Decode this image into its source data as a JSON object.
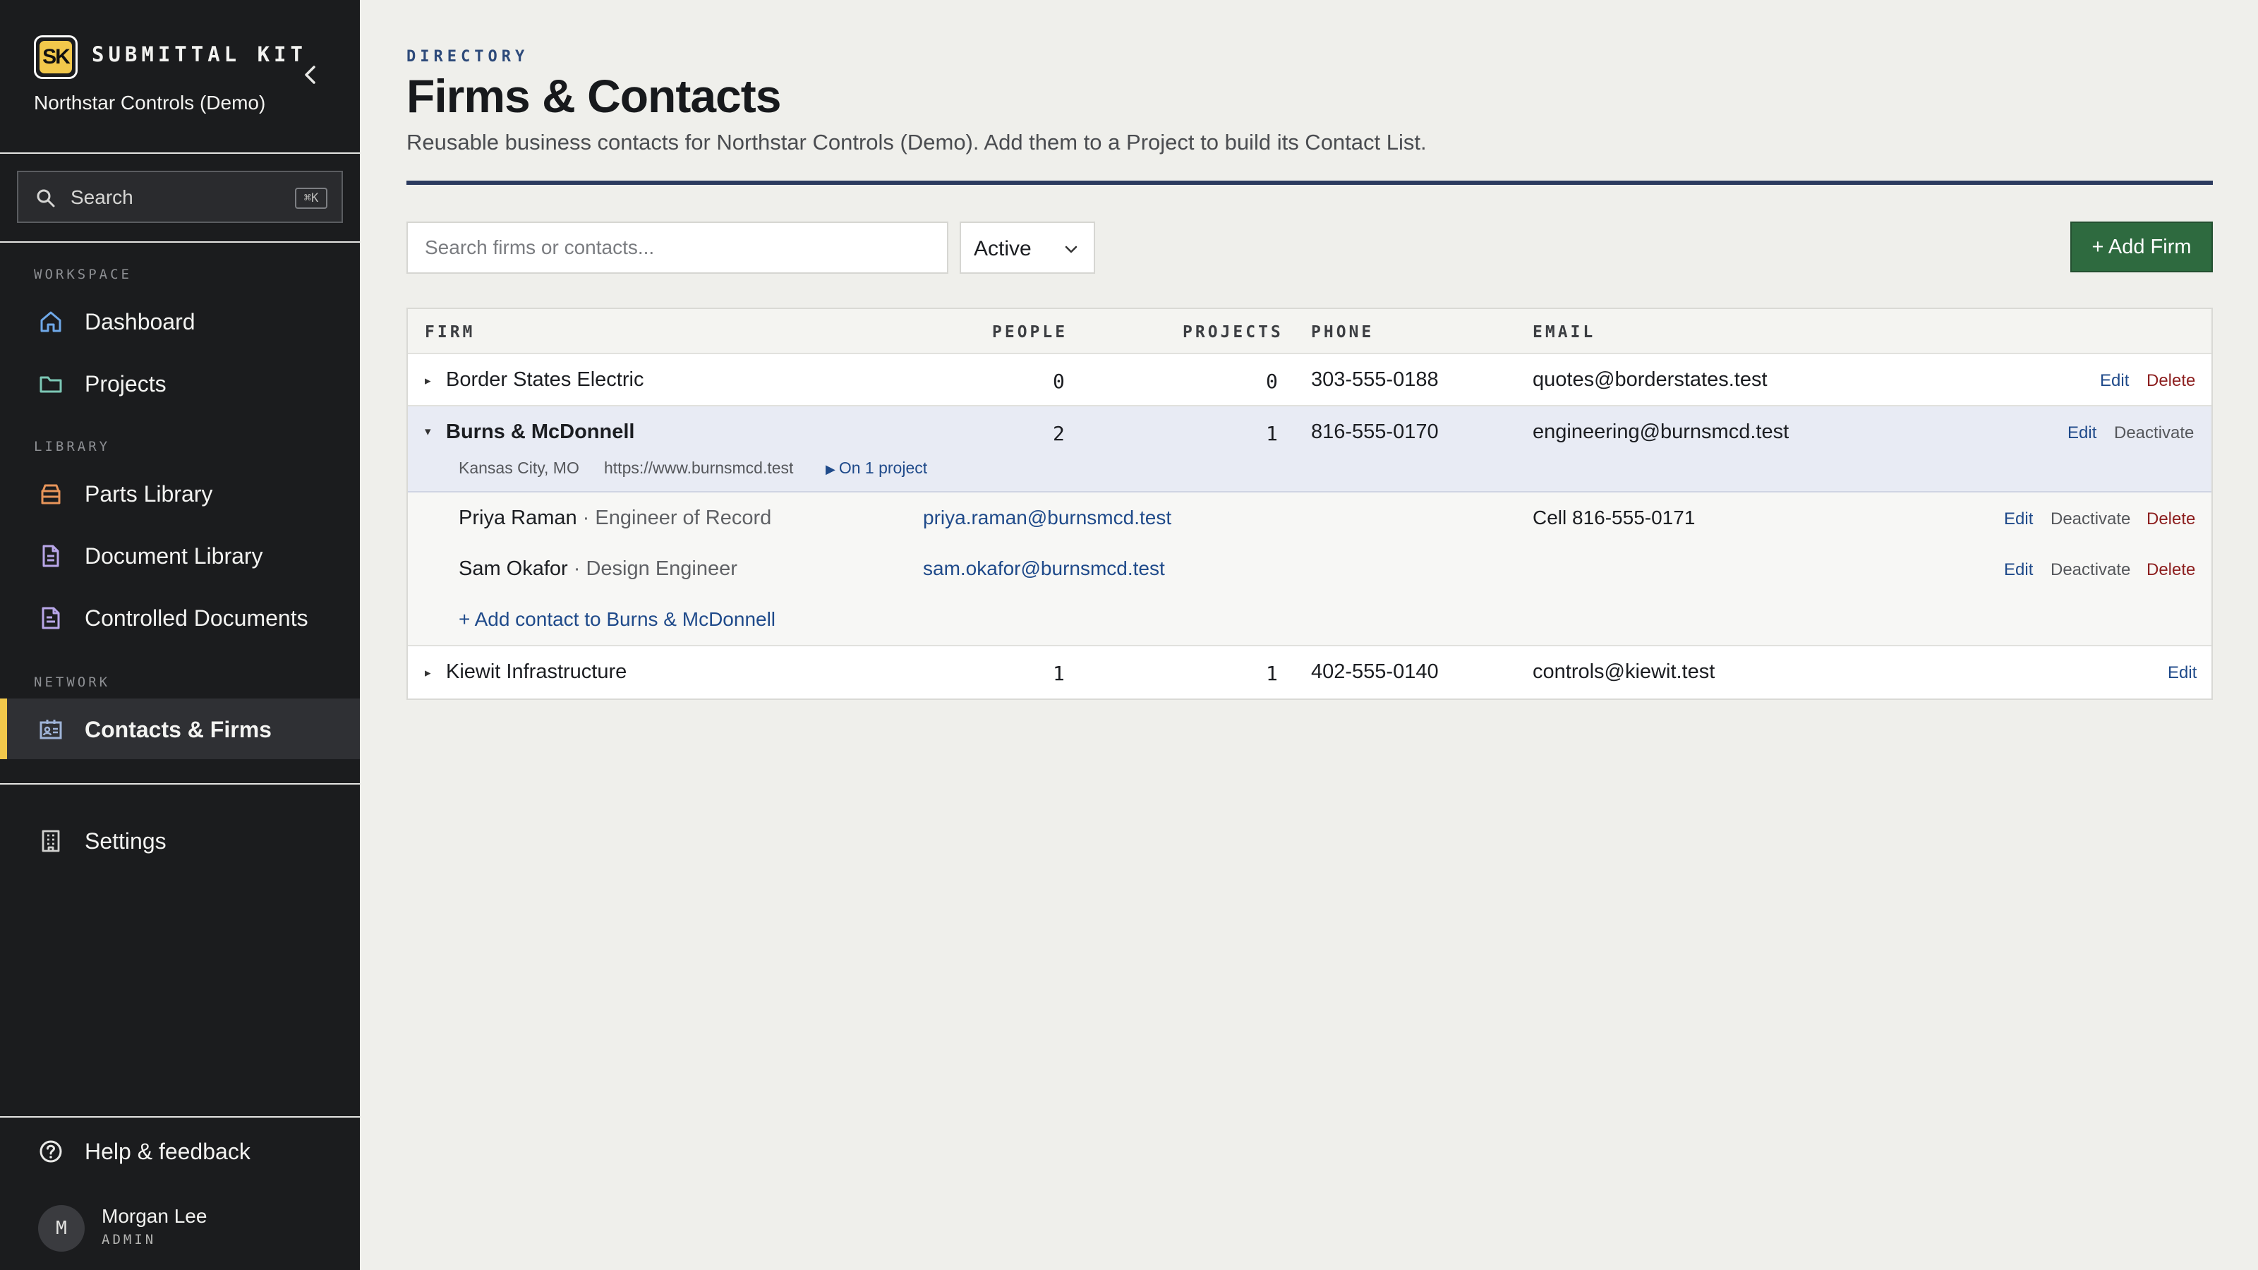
{
  "app": {
    "logo_text": "SK",
    "brand_name": "SUBMITTAL KIT",
    "org_name": "Northstar Controls (Demo)"
  },
  "sidebar": {
    "search_label": "Search",
    "search_shortcut": "⌘K",
    "sections": {
      "workspace": "WORKSPACE",
      "library": "LIBRARY",
      "network": "NETWORK"
    },
    "items": {
      "dashboard": "Dashboard",
      "projects": "Projects",
      "parts_library": "Parts Library",
      "document_library": "Document Library",
      "controlled_documents": "Controlled Documents",
      "contacts_firms": "Contacts & Firms",
      "settings": "Settings",
      "help": "Help & feedback"
    },
    "active_item": "contacts_firms",
    "user": {
      "initial": "M",
      "name": "Morgan Lee",
      "role": "ADMIN"
    }
  },
  "header": {
    "eyebrow": "DIRECTORY",
    "title": "Firms & Contacts",
    "subtitle": "Reusable business contacts for Northstar Controls (Demo). Add them to a Project to build its Contact List."
  },
  "toolbar": {
    "search_placeholder": "Search firms or contacts...",
    "status_value": "Active",
    "add_firm_label": "+ Add Firm"
  },
  "table": {
    "columns": {
      "firm": "FIRM",
      "people": "PEOPLE",
      "projects": "PROJECTS",
      "phone": "PHONE",
      "email": "EMAIL"
    },
    "rows": [
      {
        "firm": "Border States Electric",
        "people": "0",
        "projects": "0",
        "phone": "303-555-0188",
        "email": "quotes@borderstates.test",
        "actions": {
          "edit": "Edit",
          "delete": "Delete"
        }
      },
      {
        "firm": "Burns & McDonnell",
        "people": "2",
        "projects": "1",
        "phone": "816-555-0170",
        "email": "engineering@burnsmcd.test",
        "location": "Kansas City, MO",
        "website": "https://www.burnsmcd.test",
        "projects_link": "On 1 project",
        "actions": {
          "edit": "Edit",
          "deactivate": "Deactivate"
        },
        "contacts": [
          {
            "name": "Priya Raman",
            "role": " · Engineer of Record",
            "email": "priya.raman@burnsmcd.test",
            "phone": "Cell 816-555-0171",
            "actions": {
              "edit": "Edit",
              "deactivate": "Deactivate",
              "delete": "Delete"
            }
          },
          {
            "name": "Sam Okafor",
            "role": " · Design Engineer",
            "email": "sam.okafor@burnsmcd.test",
            "phone": "",
            "actions": {
              "edit": "Edit",
              "deactivate": "Deactivate",
              "delete": "Delete"
            }
          }
        ],
        "add_contact_label": "+ Add contact to Burns & McDonnell"
      },
      {
        "firm": "Kiewit Infrastructure",
        "people": "1",
        "projects": "1",
        "phone": "402-555-0140",
        "email": "controls@kiewit.test",
        "actions": {
          "edit": "Edit"
        }
      }
    ]
  },
  "colors": {
    "sidebar_bg": "#1b1c1e",
    "accent_yellow": "#f2c84b",
    "primary_green": "#2e6a3f",
    "link_blue": "#1f4a8a",
    "danger_red": "#8c1e1e",
    "rule_navy": "#2b3a5e"
  }
}
